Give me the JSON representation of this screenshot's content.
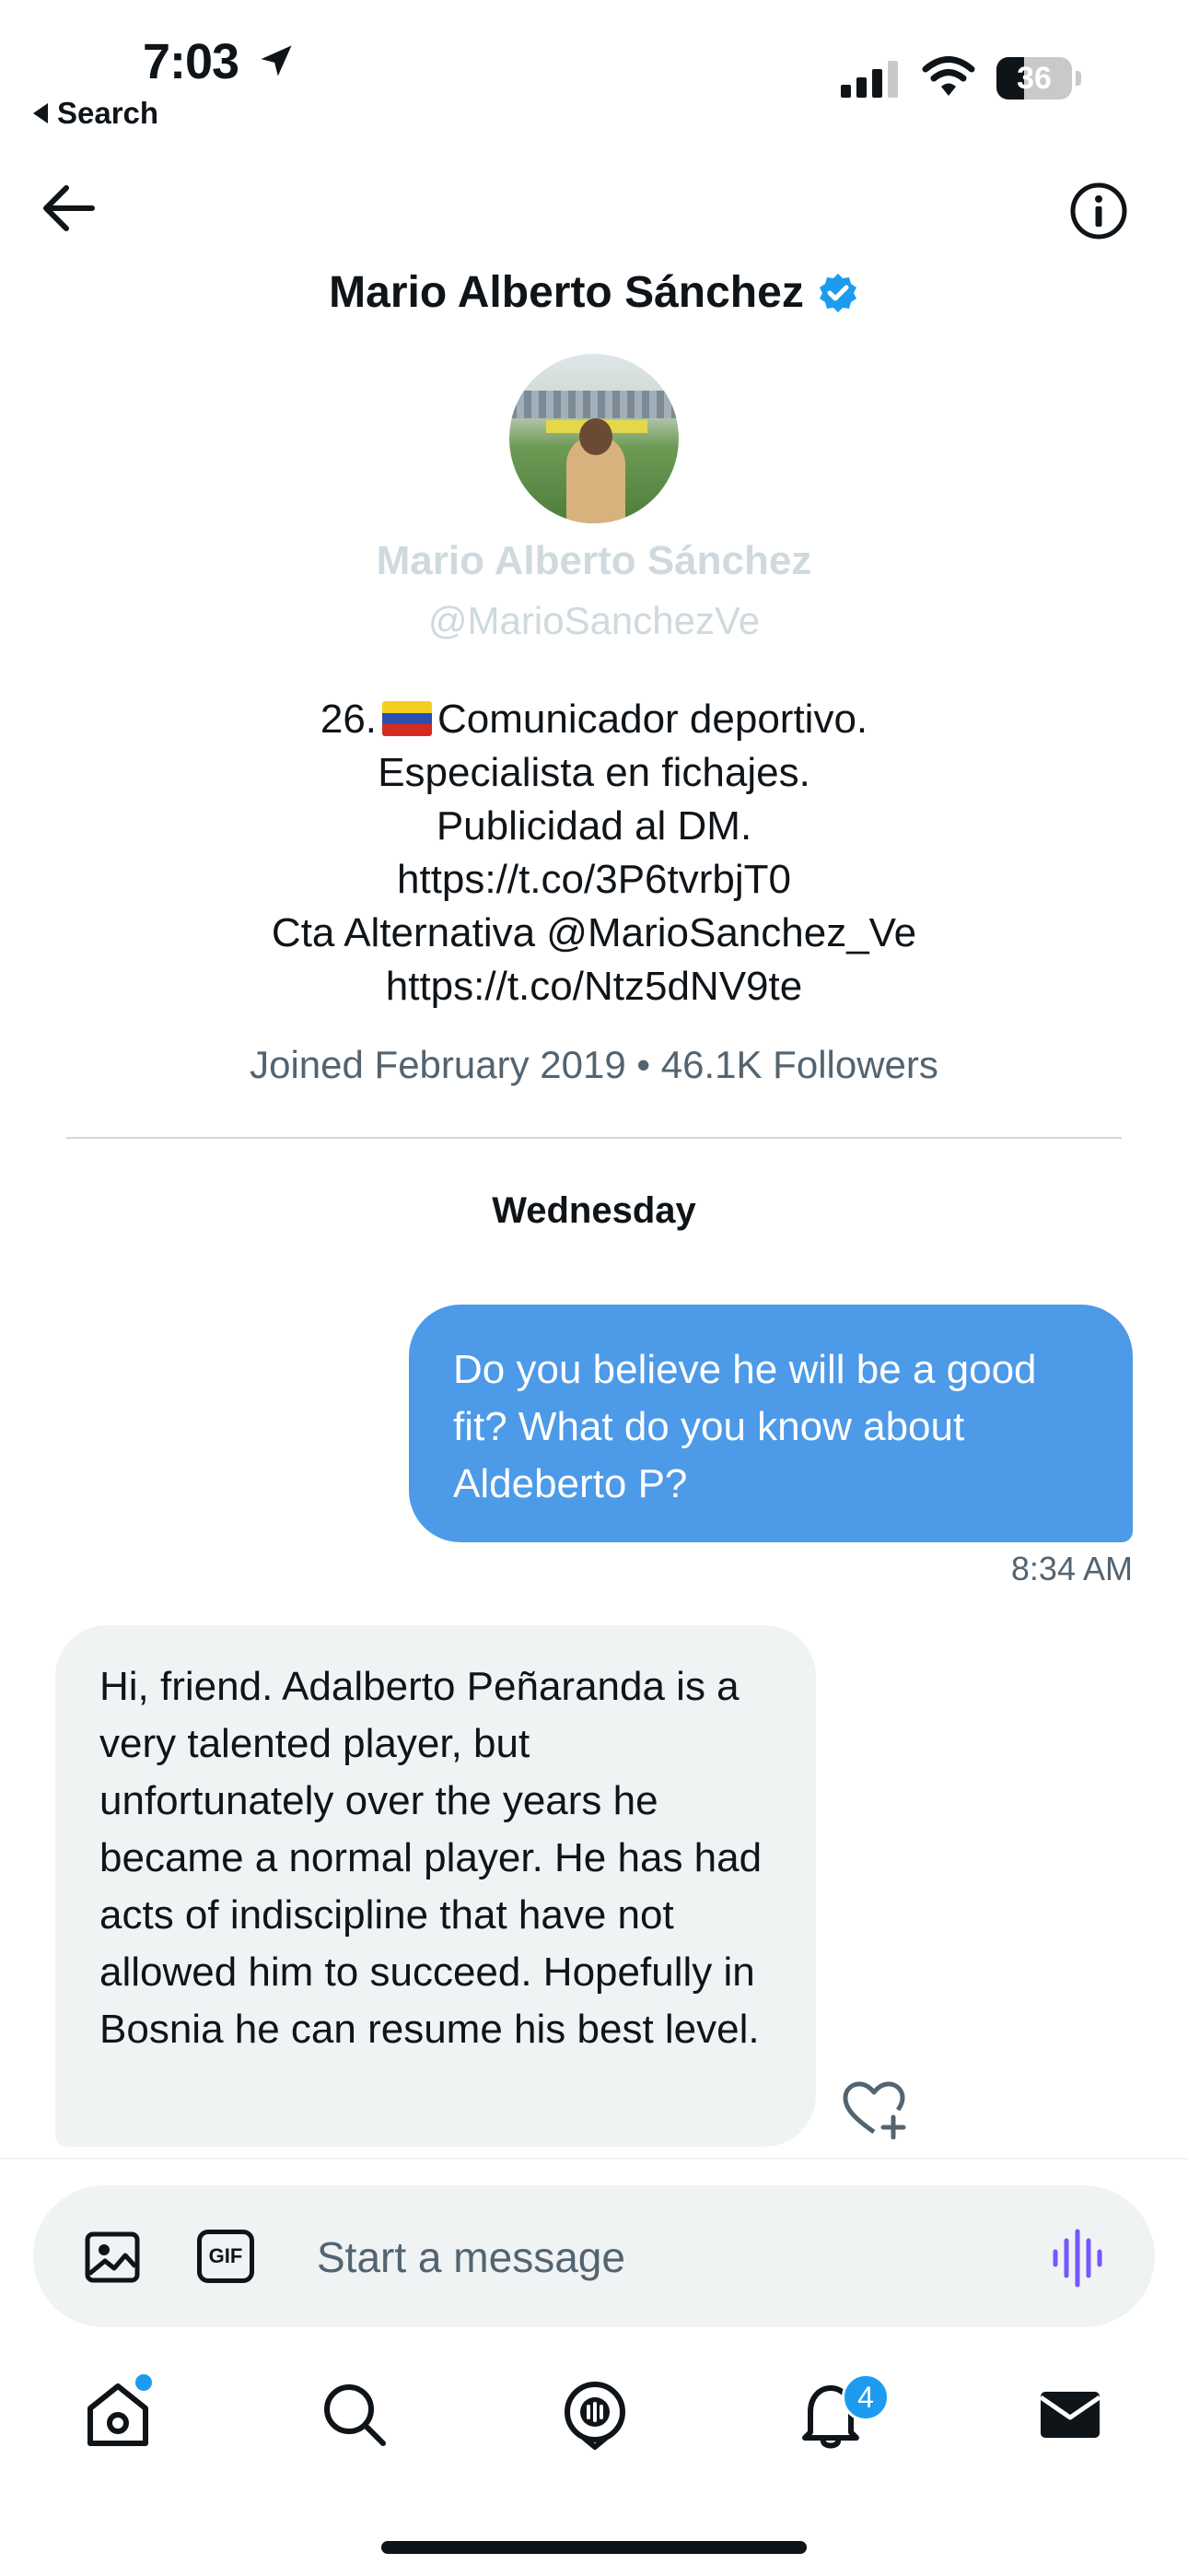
{
  "status_bar": {
    "time": "7:03",
    "back_app_label": "Search",
    "battery": "36",
    "battery_level_percent": 36
  },
  "header": {
    "name": "Mario Alberto Sánchez",
    "icons": [
      "back-arrow-icon",
      "info-icon",
      "verified-badge-icon"
    ]
  },
  "profile": {
    "name": "Mario Alberto Sánchez",
    "handle": "@MarioSanchezVe",
    "bio_lines": [
      "Comunicador deportivo.",
      "Especialista en fichajes.",
      "Publicidad al DM.",
      "https://t.co/3P6tvrbjT0",
      "Cta Alternativa @MarioSanchez_Ve",
      "https://t.co/Ntz5dNV9te"
    ],
    "bio_prefix": "26.",
    "meta": "Joined February 2019 • 46.1K Followers"
  },
  "conversation": {
    "day_label": "Wednesday",
    "messages": [
      {
        "direction": "outgoing",
        "text": "Do you believe he will be a good fit? What do you know about Aldeberto P?",
        "time": "8:34 AM"
      },
      {
        "direction": "incoming",
        "text": "Hi, friend. Adalberto Peñaranda is a very talented player, but unfortunately over the years he became a normal player. He has had acts of indiscipline that have not allowed him to succeed. Hopefully in Bosnia he can resume his best level."
      }
    ]
  },
  "composer": {
    "placeholder": "Start a message",
    "gif_label": "GIF"
  },
  "tab_bar": {
    "notifications_badge": "4",
    "items": [
      "home-icon",
      "search-icon",
      "spaces-icon",
      "notifications-icon",
      "messages-icon"
    ]
  },
  "colors": {
    "accent": "#1d9bf0",
    "outgoing_bubble": "#4c9ae8",
    "incoming_bubble": "#eff3f4",
    "voice_accent": "#7856ff"
  }
}
